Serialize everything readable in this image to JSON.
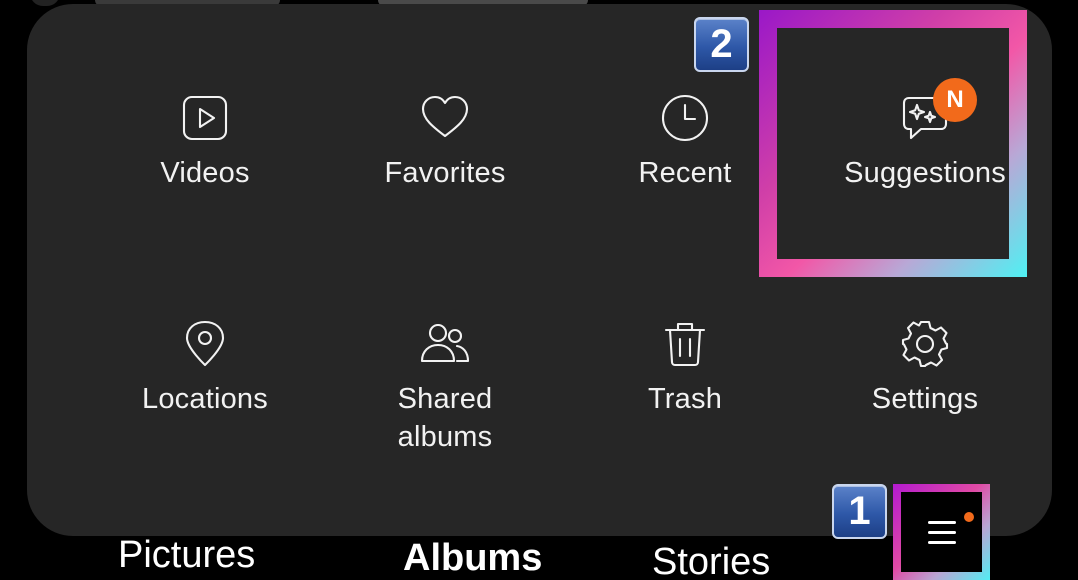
{
  "menu": {
    "items": [
      {
        "id": "videos",
        "label": "Videos",
        "icon": "video-icon"
      },
      {
        "id": "favorites",
        "label": "Favorites",
        "icon": "heart-icon"
      },
      {
        "id": "recent",
        "label": "Recent",
        "icon": "clock-icon"
      },
      {
        "id": "suggestions",
        "label": "Suggestions",
        "icon": "sparkle-chat-icon",
        "badge": "N"
      },
      {
        "id": "locations",
        "label": "Locations",
        "icon": "location-pin-icon"
      },
      {
        "id": "shared-albums",
        "label": "Shared albums",
        "icon": "people-icon"
      },
      {
        "id": "trash",
        "label": "Trash",
        "icon": "trash-icon"
      },
      {
        "id": "settings",
        "label": "Settings",
        "icon": "gear-icon"
      }
    ]
  },
  "tutorial": {
    "step_1": "1",
    "step_2": "2"
  },
  "bottom_nav": {
    "tabs": [
      {
        "label": "Pictures",
        "selected": false
      },
      {
        "label": "Albums",
        "selected": true
      },
      {
        "label": "Stories",
        "selected": false
      }
    ],
    "menu_icon": "hamburger-menu-icon"
  },
  "colors": {
    "panel_bg": "#262626",
    "background": "#000000",
    "badge_orange": "#f26a1b",
    "text": "#f2f2f2",
    "highlight_gradient_start": "#9a18c8",
    "highlight_gradient_mid": "#f257a7",
    "highlight_gradient_end": "#4ff1f3",
    "step_badge_blue": "#2e58a8"
  }
}
